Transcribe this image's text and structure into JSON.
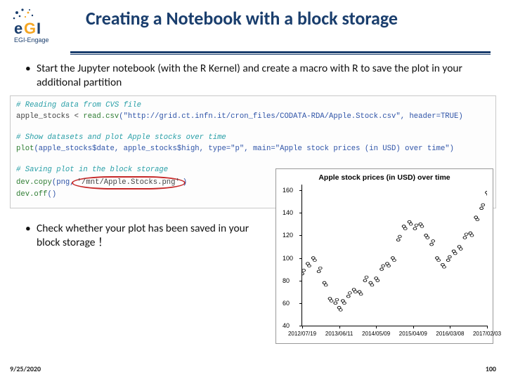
{
  "header": {
    "logo_text": "egi",
    "logo_sub": "EGI-Engage",
    "title": "Creating a Notebook with a block storage"
  },
  "bullets": {
    "b1": "Start the Jupyter notebook (with the R Kernel) and create a macro with R to save the plot in your additional partition",
    "b2": "Check whether your plot has been saved in your block storage ！"
  },
  "code": {
    "c1": "# Reading data from CVS file",
    "c2a": "apple_stocks < ",
    "c2b": "read.csv",
    "c2c": "(\"http://grid.ct.infn.it/cron_files/CODATA-RDA/Apple.Stock.csv\", header=TRUE)",
    "c3": "# Show datasets and plot Apple stocks over time",
    "c4a": "plot",
    "c4b": "(apple_stocks$date, apple_stocks$high, type=\"p\", main=\"Apple stock prices (in USD) over time\")",
    "c5": "# Saving plot in the block storage",
    "c6a": "dev.copy",
    "c6b": "(png,",
    "c6c": "'/mnt/Apple.Stocks.png'",
    "c6d": ")",
    "c7a": "dev.off",
    "c7b": "()"
  },
  "footer": {
    "date": "9/25/2020",
    "page": "100"
  },
  "chart_data": {
    "type": "scatter",
    "title": "Apple stock prices (in USD) over time",
    "xlabel": "",
    "ylabel": "",
    "ylim": [
      40,
      165
    ],
    "yticks": [
      40,
      60,
      80,
      100,
      120,
      140,
      160
    ],
    "x_categories": [
      "2012/07/19",
      "2013/06/11",
      "2014/05/09",
      "2015/04/09",
      "2016/03/08",
      "2017/02/03"
    ],
    "x": [
      0,
      0.03,
      0.06,
      0.09,
      0.12,
      0.15,
      0.18,
      0.2,
      0.22,
      0.25,
      0.28,
      0.31,
      0.34,
      0.37,
      0.4,
      0.43,
      0.46,
      0.49,
      0.52,
      0.55,
      0.58,
      0.61,
      0.64,
      0.67,
      0.7,
      0.73,
      0.76,
      0.79,
      0.82,
      0.85,
      0.88,
      0.91,
      0.94,
      0.97,
      1.0
    ],
    "values": [
      86,
      95,
      100,
      88,
      78,
      64,
      60,
      56,
      62,
      66,
      72,
      70,
      80,
      78,
      82,
      90,
      95,
      100,
      116,
      128,
      132,
      126,
      130,
      120,
      112,
      100,
      94,
      98,
      106,
      110,
      118,
      122,
      136,
      144,
      158
    ]
  }
}
